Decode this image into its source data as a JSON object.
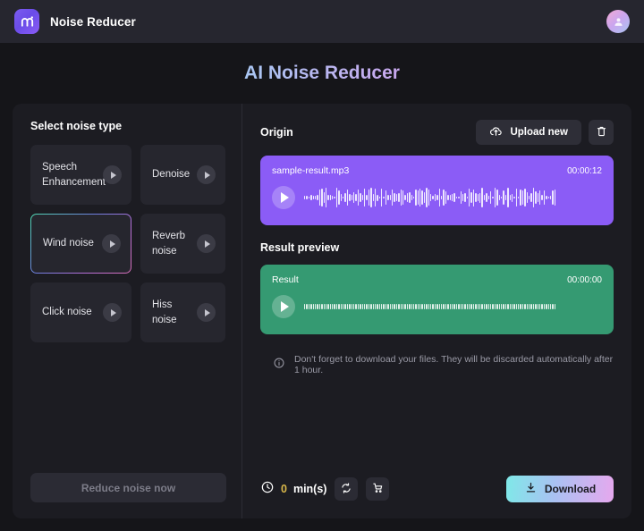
{
  "header": {
    "brand": "Noise Reducer",
    "logo_icon": "m-logo-icon",
    "avatar_icon": "user-avatar-icon"
  },
  "page": {
    "title": "AI Noise Reducer"
  },
  "left_panel": {
    "section_label": "Select noise type",
    "noise_types": [
      {
        "label": "Speech Enhancement",
        "selected": false
      },
      {
        "label": "Denoise",
        "selected": false
      },
      {
        "label": "Wind noise",
        "selected": true
      },
      {
        "label": "Reverb noise",
        "selected": false
      },
      {
        "label": "Click noise",
        "selected": false
      },
      {
        "label": "Hiss noise",
        "selected": false
      }
    ],
    "reduce_button": "Reduce noise now"
  },
  "right_panel": {
    "origin": {
      "section_label": "Origin",
      "upload_label": "Upload new",
      "upload_icon": "cloud-upload-icon",
      "delete_icon": "trash-icon",
      "file_name": "sample-result.mp3",
      "duration": "00:00:12",
      "play_icon": "play-icon"
    },
    "result": {
      "section_label": "Result preview",
      "track_name": "Result",
      "duration": "00:00:00",
      "play_icon": "play-icon"
    },
    "notice": {
      "icon": "info-icon",
      "text": "Don't forget to download your files. They will be discarded automatically after 1 hour."
    },
    "footer": {
      "clock_icon": "clock-icon",
      "credits_value": "0",
      "credits_unit": "min(s)",
      "refresh_icon": "refresh-icon",
      "cart_icon": "cart-icon",
      "download_label": "Download",
      "download_icon": "download-icon"
    }
  },
  "colors": {
    "accent_purple": "#8b5cf6",
    "accent_green": "#359a72",
    "gradient_start": "#7fe8e8",
    "gradient_end": "#e6a8ee",
    "credits_gold": "#d8b74a"
  }
}
